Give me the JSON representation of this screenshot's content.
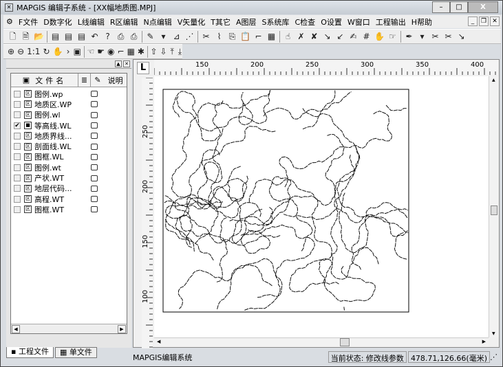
{
  "title": "MAPGIS 编辑子系统 - [XX幅地质图.MPJ]",
  "window_buttons": {
    "minimize": "–",
    "maximize": "□",
    "close": "X"
  },
  "menu": [
    "F文件",
    "D数字化",
    "L线编辑",
    "R区编辑",
    "N点编辑",
    "V矢量化",
    "T其它",
    "A图层",
    "S系统库",
    "C检查",
    "O设置",
    "W窗口",
    "工程输出",
    "H帮助"
  ],
  "toolbar2_zoom_label": "1:1",
  "panel": {
    "columns": {
      "name": "文件名",
      "desc": "说明"
    },
    "files": [
      {
        "name": "图例.wp",
        "checked": false,
        "active": false
      },
      {
        "name": "地质区.WP",
        "checked": false,
        "active": false
      },
      {
        "name": "图例.wl",
        "checked": false,
        "active": false
      },
      {
        "name": "等高线.WL",
        "checked": true,
        "active": true
      },
      {
        "name": "地质界线...",
        "checked": false,
        "active": false
      },
      {
        "name": "剖面线.WL",
        "checked": false,
        "active": false
      },
      {
        "name": "图框.WL",
        "checked": false,
        "active": false
      },
      {
        "name": "图例.wt",
        "checked": false,
        "active": false
      },
      {
        "name": "产状.WT",
        "checked": false,
        "active": false
      },
      {
        "name": "地层代码...",
        "checked": false,
        "active": false
      },
      {
        "name": "高程.WT",
        "checked": false,
        "active": false
      },
      {
        "name": "图框.WT",
        "checked": false,
        "active": false
      }
    ],
    "tabs": [
      "工程文件",
      "单文件"
    ]
  },
  "ruler": {
    "top": [
      "150",
      "200",
      "250",
      "300",
      "350",
      "400"
    ],
    "left": [
      "250",
      "200",
      "150",
      "100"
    ]
  },
  "status": {
    "app": "MAPGIS编辑系统",
    "state": "当前状态: 修改线参数",
    "coords": "478.71,126.66(毫米)"
  }
}
